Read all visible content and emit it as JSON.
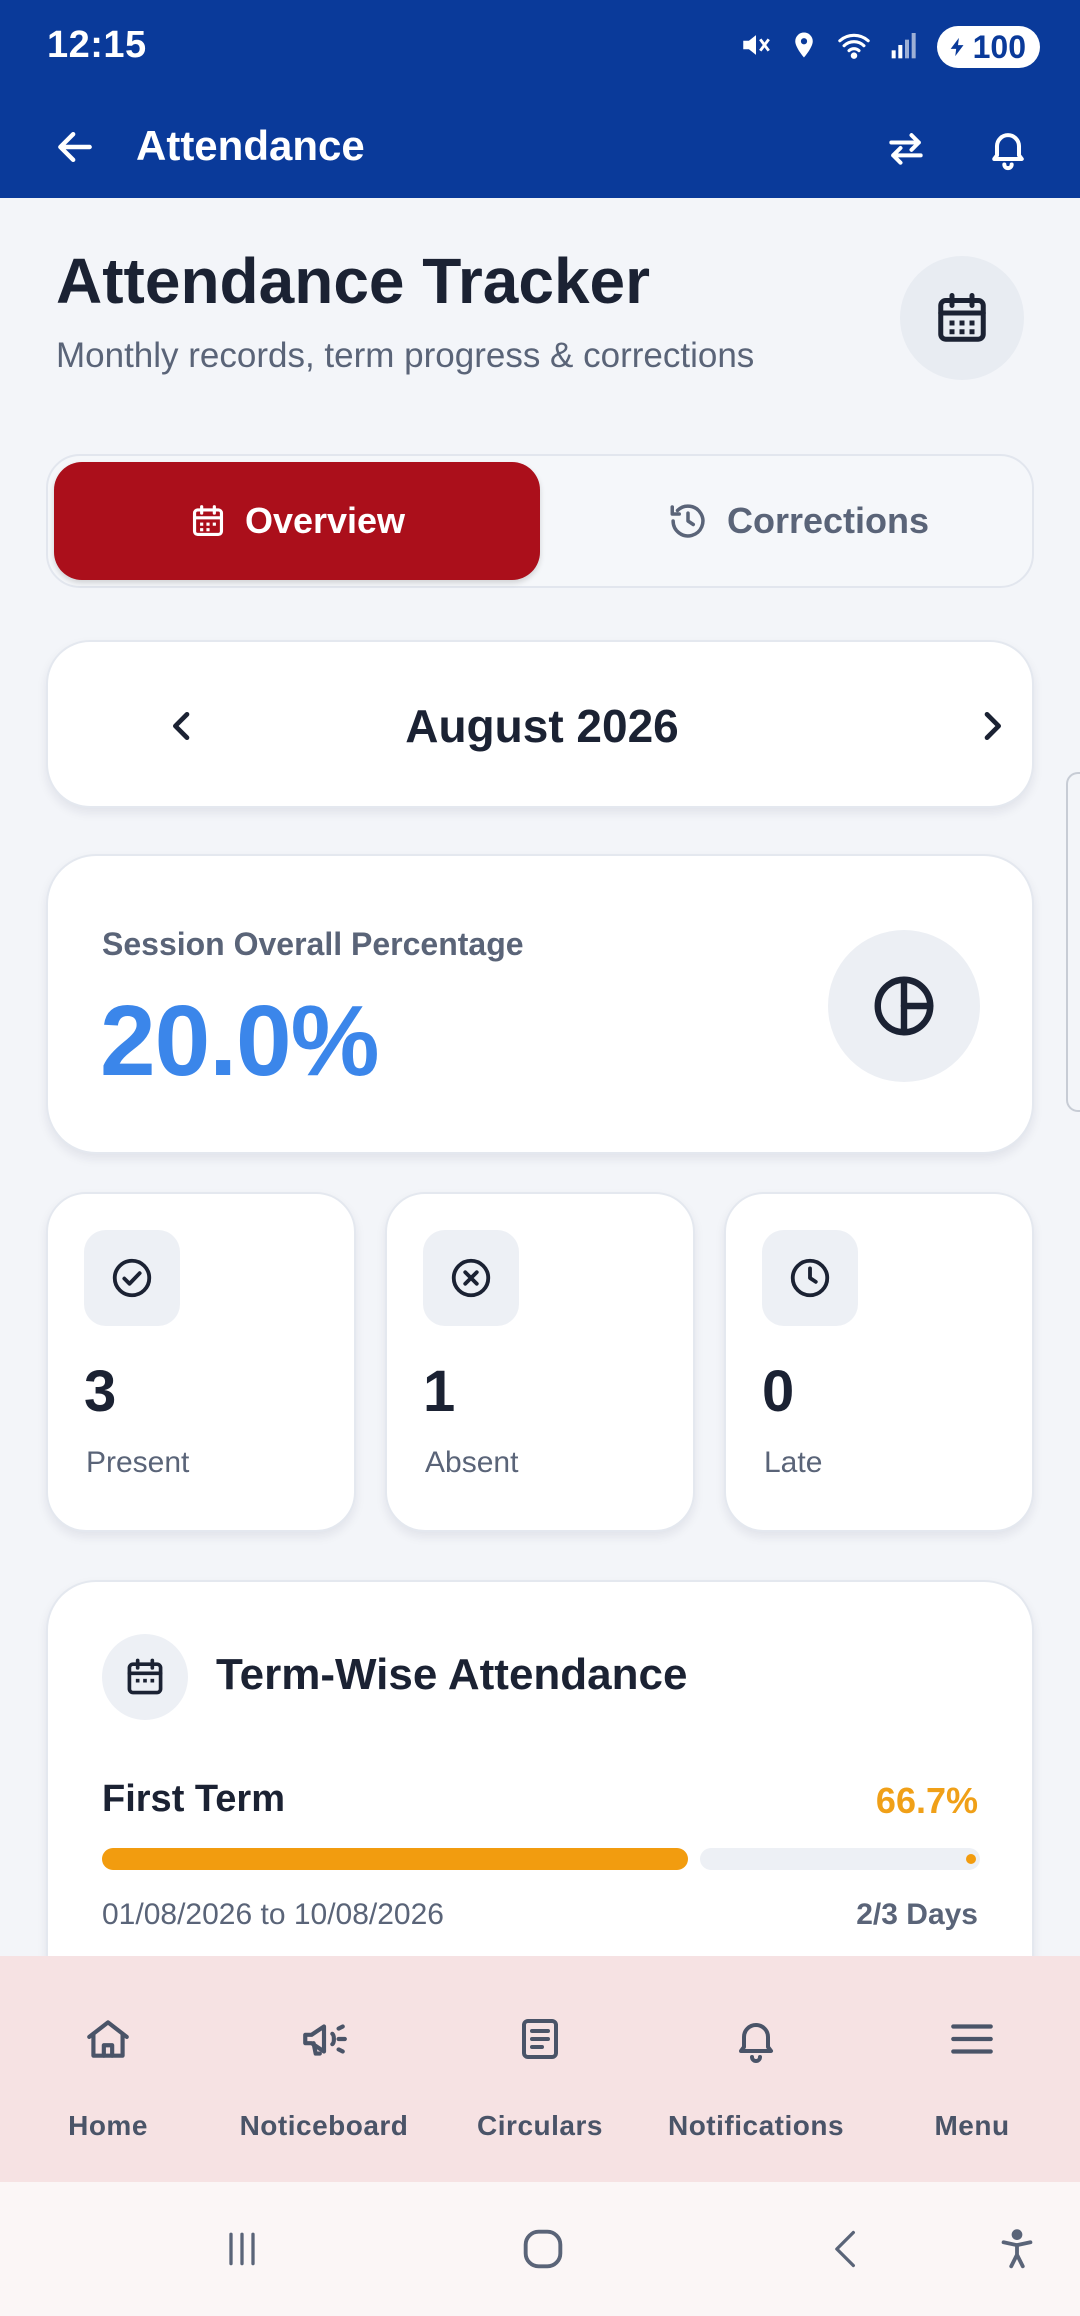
{
  "status_bar": {
    "time": "12:15",
    "battery": "100"
  },
  "app_bar": {
    "title": "Attendance"
  },
  "header": {
    "title": "Attendance Tracker",
    "subtitle": "Monthly records, term progress & corrections"
  },
  "tabs": [
    {
      "label": "Overview",
      "active": true
    },
    {
      "label": "Corrections",
      "active": false
    }
  ],
  "month_nav": {
    "month": "August 2026"
  },
  "session": {
    "label": "Session Overall Percentage",
    "percentage": "20.0%"
  },
  "stats": [
    {
      "value": "3",
      "label": "Present",
      "icon": "check-circle-icon"
    },
    {
      "value": "1",
      "label": "Absent",
      "icon": "x-circle-icon"
    },
    {
      "value": "0",
      "label": "Late",
      "icon": "clock-icon"
    }
  ],
  "term_section": {
    "title": "Term-Wise Attendance",
    "terms": [
      {
        "name": "First Term",
        "percentage": "66.7%",
        "progress": 0.667,
        "date_range": "01/08/2026 to 10/08/2026",
        "days": "2/3 Days"
      }
    ]
  },
  "bottom_nav": [
    {
      "label": "Home",
      "icon": "home-icon"
    },
    {
      "label": "Noticeboard",
      "icon": "megaphone-icon"
    },
    {
      "label": "Circulars",
      "icon": "document-icon"
    },
    {
      "label": "Notifications",
      "icon": "bell-icon"
    },
    {
      "label": "Menu",
      "icon": "menu-icon"
    }
  ],
  "colors": {
    "primary_blue": "#0a3a9a",
    "accent_red": "#ab0f1b",
    "percentage_blue": "#3b86ea",
    "term_orange": "#f29c0f",
    "nav_background": "#f6e2e3"
  }
}
